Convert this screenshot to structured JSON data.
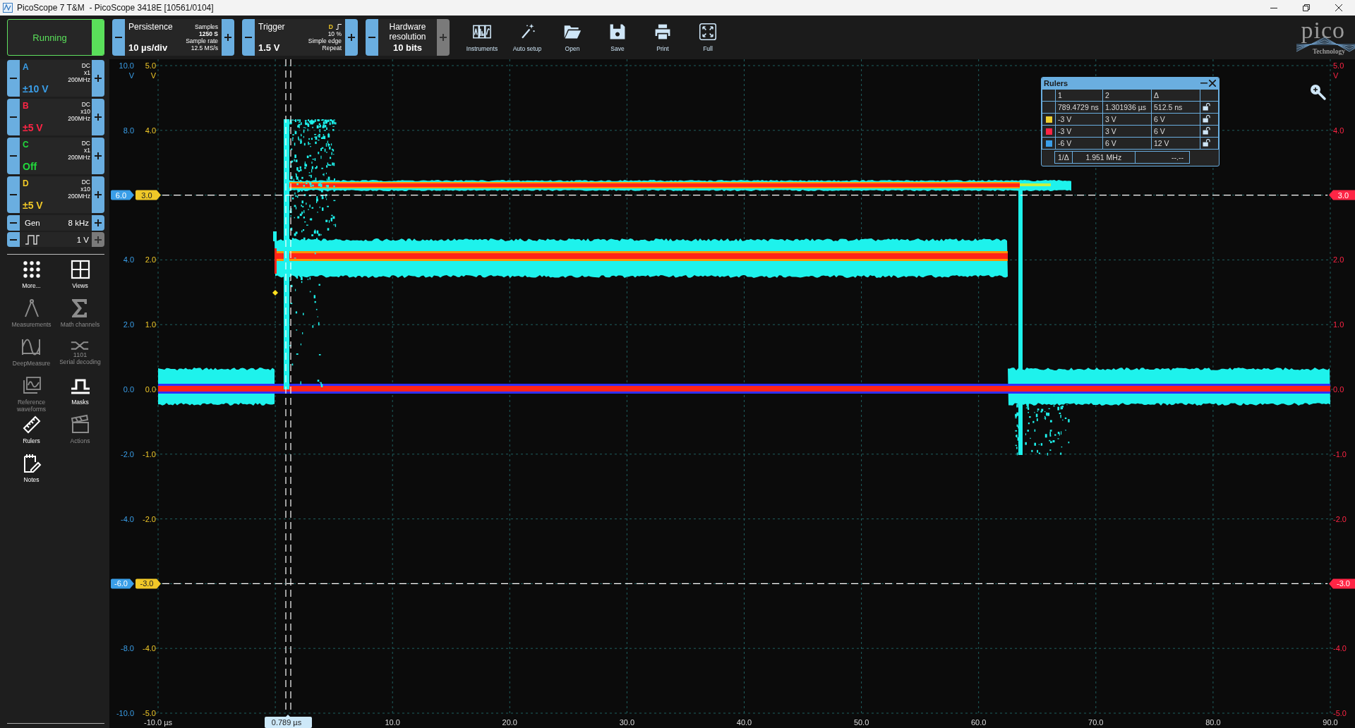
{
  "window": {
    "title": "PicoScope 7 T&M  - PicoScope 3418E [10561/0104]"
  },
  "toolbar": {
    "run_button": {
      "label": "Running",
      "on": true
    },
    "controls": [
      {
        "kind": "persistence",
        "title": "Persistence",
        "value": "10 µs/div",
        "details": [
          {
            "text": "Samples",
            "bold": false
          },
          {
            "text": "1250 S",
            "bold": true
          },
          {
            "text": "Sample rate",
            "bold": false
          },
          {
            "text": "12.5 MS/s",
            "bold": false
          }
        ]
      },
      {
        "kind": "trigger",
        "title": "Trigger",
        "value": "1.5 V",
        "source": "D",
        "color": "#f0c828",
        "details": [
          {
            "text": "10 %",
            "bold": false
          },
          {
            "text": "Simple edge",
            "bold": false
          },
          {
            "text": "Repeat",
            "bold": false
          }
        ]
      },
      {
        "kind": "resolution",
        "title": "Hardware resolution",
        "value": "10 bits",
        "increase_disabled": true
      }
    ],
    "buttons": [
      {
        "kind": "instruments",
        "label": "Instruments"
      },
      {
        "kind": "auto-setup",
        "label": "Auto setup"
      },
      {
        "kind": "open",
        "label": "Open"
      },
      {
        "kind": "save",
        "label": "Save"
      },
      {
        "kind": "print",
        "label": "Print"
      },
      {
        "kind": "full",
        "label": "Full"
      }
    ],
    "logo": {
      "name": "pico",
      "tagline": "Technology"
    }
  },
  "sidebar": {
    "channels": [
      {
        "name": "A",
        "coupling": "DC",
        "probe": "x1",
        "bandwidth": "200MHz",
        "range": "±10 V",
        "color": "#3a9ee8"
      },
      {
        "name": "B",
        "coupling": "DC",
        "probe": "x10",
        "bandwidth": "200MHz",
        "range": "±5 V",
        "color": "#ff2545"
      },
      {
        "name": "C",
        "coupling": "DC",
        "probe": "x1",
        "bandwidth": "200MHz",
        "range": "Off",
        "color": "#22d83c"
      },
      {
        "name": "D",
        "coupling": "DC",
        "probe": "x10",
        "bandwidth": "200MHz",
        "range": "±5 V",
        "color": "#f0c828"
      }
    ],
    "generator": {
      "label": "Gen",
      "frequency": "8 kHz",
      "amplitude": "1 V",
      "amplitude_increase_disabled": true
    },
    "serial_icon_caption": "1101",
    "tools": [
      {
        "kind": "more",
        "label": "More...",
        "disabled": false
      },
      {
        "kind": "views",
        "label": "Views",
        "disabled": false
      },
      {
        "kind": "measurements",
        "label": "Measurements",
        "disabled": true
      },
      {
        "kind": "math",
        "label": "Math channels",
        "disabled": true
      },
      {
        "kind": "deepmeasure",
        "label": "DeepMeasure",
        "disabled": true
      },
      {
        "kind": "serial",
        "label": "Serial decoding",
        "disabled": true
      },
      {
        "kind": "reference",
        "label": "Reference waveforms",
        "disabled": true
      },
      {
        "kind": "masks",
        "label": "Masks",
        "disabled": false
      },
      {
        "kind": "rulers",
        "label": "Rulers",
        "disabled": false
      },
      {
        "kind": "actions",
        "label": "Actions",
        "disabled": true
      },
      {
        "kind": "notes",
        "label": "Notes",
        "disabled": false
      }
    ]
  },
  "plot": {
    "axes": [
      {
        "color": "#3a9ee8",
        "unit": "V",
        "ticks": [
          {
            "text": "10.0"
          },
          {
            "text": "8.0"
          },
          {
            "text": "6.0",
            "kind": "marker"
          },
          {
            "text": "4.0"
          },
          {
            "text": "2.0"
          },
          {
            "text": "0.0"
          },
          {
            "text": "-2.0"
          },
          {
            "text": "-4.0"
          },
          {
            "text": "-6.0",
            "kind": "marker"
          },
          {
            "text": "-8.0"
          },
          {
            "text": "-10.0"
          }
        ]
      },
      {
        "color": "#f0c828",
        "unit": "V",
        "ticks": [
          {
            "text": "5.0"
          },
          {
            "text": "4.0"
          },
          {
            "text": "3.0",
            "kind": "marker"
          },
          {
            "text": "2.0"
          },
          {
            "text": "1.0"
          },
          {
            "text": "0.0"
          },
          {
            "text": "-1.0"
          },
          {
            "text": "-2.0"
          },
          {
            "text": "-3.0",
            "kind": "marker"
          },
          {
            "text": "-4.0"
          },
          {
            "text": "-5.0"
          }
        ]
      },
      {
        "color": "#ff2545",
        "unit": "V",
        "ticks": [
          {
            "text": "5.0"
          },
          {
            "text": "4.0"
          },
          {
            "text": "3.0",
            "kind": "marker"
          },
          {
            "text": "2.0"
          },
          {
            "text": "1.0"
          },
          {
            "text": "0.0"
          },
          {
            "text": "-1.0"
          },
          {
            "text": "-2.0"
          },
          {
            "text": "-3.0",
            "kind": "marker"
          },
          {
            "text": "-4.0"
          },
          {
            "text": "-5.0"
          }
        ]
      }
    ],
    "time_axis": {
      "ticks": [
        "-10.0 µs",
        "10.0",
        "20.0",
        "30.0",
        "40.0",
        "50.0",
        "60.0",
        "70.0",
        "80.0",
        "90.0"
      ],
      "ruler_label": "0.789 µs"
    }
  },
  "rulers_panel": {
    "title": "Rulers",
    "columns": [
      "1",
      "2",
      "Δ"
    ],
    "rows": [
      {
        "values": [
          "789.4729 ns",
          "1.301936 µs",
          "512.5 ns"
        ]
      },
      {
        "color": "#f0d030",
        "values": [
          "-3 V",
          "3 V",
          "6 V"
        ]
      },
      {
        "color": "#ff2545",
        "values": [
          "-3 V",
          "3 V",
          "6 V"
        ]
      },
      {
        "color": "#3a9ee8",
        "values": [
          "-6 V",
          "6 V",
          "12 V"
        ]
      }
    ],
    "footer": [
      "1/Δ",
      "1.951 MHz",
      "--.--"
    ]
  }
}
